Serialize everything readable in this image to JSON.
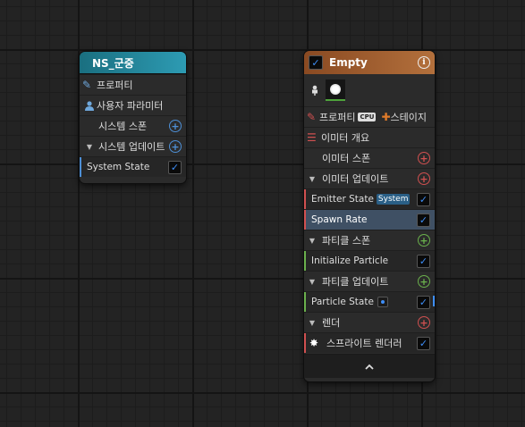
{
  "system_node": {
    "title": "NS_군중",
    "rows": {
      "properties": "프로퍼티",
      "user_params": "사용자 파라미터",
      "system_spawn": "시스템 스폰",
      "system_update": "시스템 업데이트",
      "system_state": "System State"
    },
    "colors": {
      "header": "#1f7f93"
    }
  },
  "emitter_node": {
    "title": "Empty",
    "rows": {
      "properties": "프로퍼티",
      "cpu_badge": "CPU",
      "add_stage": "스테이지",
      "emitter_summary": "이미터 개요",
      "emitter_spawn": "이미터 스폰",
      "emitter_update": "이미터 업데이트",
      "emitter_state": "Emitter State",
      "emitter_state_tag": "System",
      "spawn_rate": "Spawn Rate",
      "particle_spawn": "파티클 스폰",
      "initialize_particle": "Initialize Particle",
      "particle_update": "파티클 업데이트",
      "particle_state": "Particle State",
      "render": "렌더",
      "sprite_renderer": "스프라이트 렌더러"
    },
    "colors": {
      "header": "#9c5a2a",
      "emitter_accent": "#d05050",
      "particle_accent": "#6ab04c"
    }
  }
}
